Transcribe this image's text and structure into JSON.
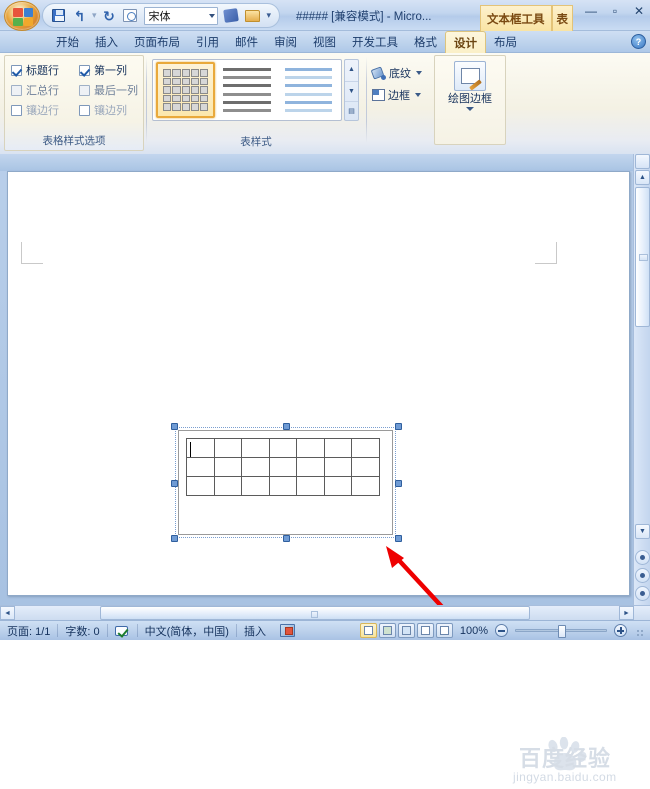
{
  "window": {
    "title": "##### [兼容模式] - Micro...",
    "minimize": "—",
    "maximize": "▫",
    "close": "✕"
  },
  "quick_access": {
    "font_value": "宋体",
    "save_tip": "保存",
    "undo_glyph": "↰",
    "redo_glyph": "↻",
    "more_glyph": "▾"
  },
  "contextual_tabs": [
    {
      "label": "文本框工具"
    },
    {
      "label": "表"
    }
  ],
  "ribbon": {
    "tabs": [
      {
        "label": "开始",
        "active": false
      },
      {
        "label": "插入",
        "active": false
      },
      {
        "label": "页面布局",
        "active": false
      },
      {
        "label": "引用",
        "active": false
      },
      {
        "label": "邮件",
        "active": false
      },
      {
        "label": "审阅",
        "active": false
      },
      {
        "label": "视图",
        "active": false
      },
      {
        "label": "开发工具",
        "active": false
      },
      {
        "label": "格式",
        "active": false
      },
      {
        "label": "设计",
        "active": true
      },
      {
        "label": "布局",
        "active": false
      }
    ],
    "help_label": "?",
    "groups": {
      "table_style_options": {
        "label": "表格样式选项",
        "checkboxes": [
          {
            "label": "标题行",
            "checked": true
          },
          {
            "label": "第一列",
            "checked": true
          },
          {
            "label": "汇总行",
            "checked": false
          },
          {
            "label": "最后一列",
            "checked": false
          },
          {
            "label": "镶边行",
            "checked": false
          },
          {
            "label": "镶边列",
            "checked": false
          }
        ]
      },
      "table_styles": {
        "label": "表样式",
        "gallery_items": [
          {
            "name": "表格网格式",
            "selected": true
          },
          {
            "name": "深色底纹样式",
            "selected": false
          },
          {
            "name": "浅色蓝色样式",
            "selected": false
          }
        ],
        "scroll_up": "▲",
        "scroll_down": "▼",
        "scroll_more": "▤"
      },
      "borders": {
        "shading_label": "底纹",
        "border_label": "边框"
      },
      "draw_borders": {
        "label": "绘图边框",
        "button_label": "绘图边框"
      }
    }
  },
  "document": {
    "textbox": {
      "selected": true,
      "table_columns": 7,
      "table_rows": 3,
      "cursor_in_cell": "r1c1"
    },
    "annotation": {
      "type": "arrow",
      "color": "#ee0000"
    }
  },
  "watermark": {
    "brand": "百度经验",
    "url": "jingyan.baidu.com"
  },
  "status_bar": {
    "page": "页面: 1/1",
    "words": "字数: 0",
    "language": "中文(简体，中国)",
    "insert_mode": "插入",
    "zoom_level": "100%",
    "zoom_out": "−",
    "zoom_in": "+",
    "view_buttons": [
      {
        "name": "page-layout-view",
        "active": true
      },
      {
        "name": "full-screen-reading-view",
        "active": false
      },
      {
        "name": "web-layout-view",
        "active": false
      },
      {
        "name": "outline-view",
        "active": false
      },
      {
        "name": "draft-view",
        "active": false
      }
    ]
  },
  "scrollbars": {
    "v_up": "▲",
    "v_down": "▼",
    "h_left": "◄",
    "h_right": "►"
  },
  "colors": {
    "accent": "#e9a93b",
    "titlebar": "#c3d6ef",
    "annotation": "#ee0000"
  }
}
